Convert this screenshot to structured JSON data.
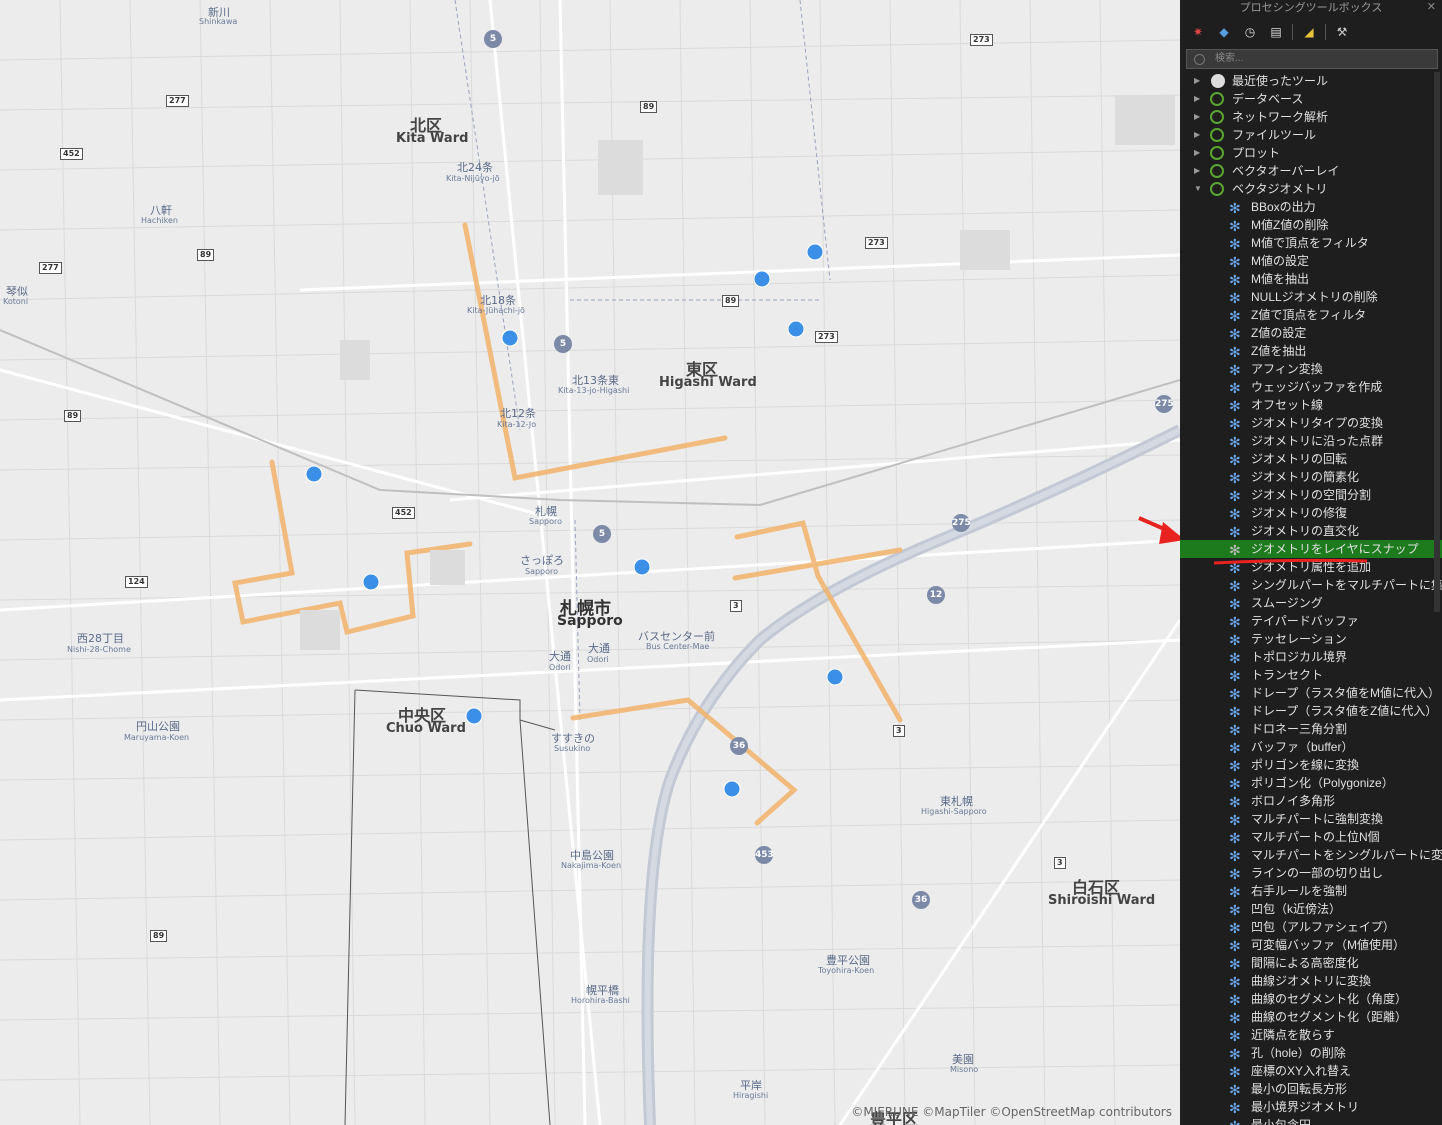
{
  "map": {
    "attribution": "©MIERUNE ©MapTiler ©OpenStreetMap contributors",
    "wards": [
      {
        "ja": "北区",
        "en": "Kita Ward"
      },
      {
        "ja": "東区",
        "en": "Higashi Ward"
      },
      {
        "ja": "中央区",
        "en": "Chuo Ward"
      },
      {
        "ja": "白石区",
        "en": "Shiroishi Ward"
      },
      {
        "ja": "豊平区",
        "en": ""
      }
    ],
    "city": {
      "ja": "札幌市",
      "en": "Sapporo"
    },
    "stations": [
      {
        "ja": "北24条",
        "en": "Kita-Nijūyo-jō"
      },
      {
        "ja": "北18条",
        "en": "Kita-Jūhachi-jō"
      },
      {
        "ja": "北13条東",
        "en": "Kita-13-jo-Higashi"
      },
      {
        "ja": "北12条",
        "en": "Kita-12-Jo"
      },
      {
        "ja": "札幌",
        "en": "Sapporo"
      },
      {
        "ja": "さっぽろ",
        "en": "Sapporo"
      },
      {
        "ja": "大通",
        "en": "Odori"
      },
      {
        "ja": "大通",
        "en": "Odori"
      },
      {
        "ja": "バスセンター前",
        "en": "Bus Center-Mae"
      },
      {
        "ja": "すすきの",
        "en": "Susukino"
      },
      {
        "ja": "中島公園",
        "en": "Nakajima-Koen"
      },
      {
        "ja": "幌平橋",
        "en": "Horohira-Bashi"
      },
      {
        "ja": "平岸",
        "en": "Hiragishi"
      },
      {
        "ja": "美園",
        "en": "Misono"
      },
      {
        "ja": "豊平公園",
        "en": "Toyohira-Koen"
      },
      {
        "ja": "東札幌",
        "en": "Higashi-Sapporo"
      },
      {
        "ja": "円山公園",
        "en": "Maruyama-Koen"
      },
      {
        "ja": "西28丁目",
        "en": "Nishi-28-Chome"
      },
      {
        "ja": "八軒",
        "en": "Hachiken"
      },
      {
        "ja": "琴似",
        "en": "Kotoni"
      },
      {
        "ja": "新川",
        "en": "Shinkawa"
      }
    ],
    "shields": [
      "5",
      "5",
      "5",
      "89",
      "89",
      "89",
      "89",
      "89",
      "273",
      "273",
      "273",
      "275",
      "275",
      "277",
      "277",
      "452",
      "452",
      "124",
      "3",
      "3",
      "3",
      "12",
      "36",
      "36",
      "453"
    ]
  },
  "panel": {
    "title": "プロセシングツールボックス",
    "search_placeholder": "検索...",
    "groups": [
      {
        "label": "最近使ったツール",
        "expanded": false
      },
      {
        "label": "データベース",
        "expanded": false
      },
      {
        "label": "ネットワーク解析",
        "expanded": false
      },
      {
        "label": "ファイルツール",
        "expanded": false
      },
      {
        "label": "プロット",
        "expanded": false
      },
      {
        "label": "ベクタオーバーレイ",
        "expanded": false
      },
      {
        "label": "ベクタジオメトリ",
        "expanded": true
      }
    ],
    "tools": [
      "BBoxの出力",
      "M値Z値の削除",
      "M値で頂点をフィルタ",
      "M値の設定",
      "M値を抽出",
      "NULLジオメトリの削除",
      "Z値で頂点をフィルタ",
      "Z値の設定",
      "Z値を抽出",
      "アフィン変換",
      "ウェッジバッファを作成",
      "オフセット線",
      "ジオメトリタイプの変換",
      "ジオメトリに沿った点群",
      "ジオメトリの回転",
      "ジオメトリの簡素化",
      "ジオメトリの空間分割",
      "ジオメトリの修復",
      "ジオメトリの直交化",
      "ジオメトリをレイヤにスナップ",
      "ジオメトリ属性を追加",
      "シングルパートをマルチパートに集約",
      "スムージング",
      "テイパードバッファ",
      "テッセレーション",
      "トポロジカル境界",
      "トランセクト",
      "ドレープ（ラスタ値をM値に代入）",
      "ドレープ（ラスタ値をZ値に代入）",
      "ドロネー三角分割",
      "バッファ（buffer）",
      "ポリゴンを線に変換",
      "ポリゴン化（Polygonize）",
      "ボロノイ多角形",
      "マルチパートに強制変換",
      "マルチパートの上位N個",
      "マルチパートをシングルパートに変換",
      "ラインの一部の切り出し",
      "右手ルールを強制",
      "凹包（k近傍法）",
      "凹包（アルファシェイプ）",
      "可変幅バッファ（M値使用）",
      "間隔による高密度化",
      "曲線ジオメトリに変換",
      "曲線のセグメント化（角度）",
      "曲線のセグメント化（距離）",
      "近隣点を散らす",
      "孔（hole）の削除",
      "座標のXY入れ替え",
      "最小の回転長方形",
      "最小境界ジオメトリ",
      "最小包含円"
    ],
    "selected_tool": "ジオメトリをレイヤにスナップ",
    "colors": {
      "selected": "#1d7a1d",
      "annotation": "#e8231f",
      "point": "#3b8fe6",
      "line": "#f2b36b"
    }
  }
}
